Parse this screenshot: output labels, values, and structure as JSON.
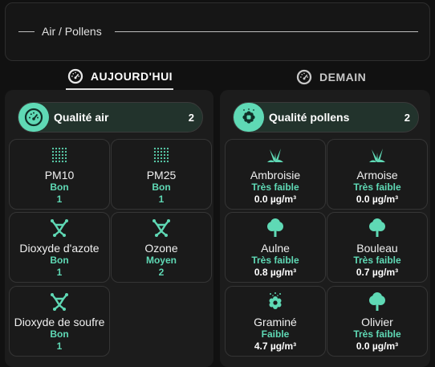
{
  "header": {
    "title": "Air / Pollens"
  },
  "tabs": [
    {
      "label": "AUJOURD'HUI",
      "icon": "gauge-icon",
      "active": true
    },
    {
      "label": "DEMAIN",
      "icon": "gauge-icon",
      "active": false
    }
  ],
  "air": {
    "summary": {
      "label": "Qualité air",
      "count": "2",
      "icon": "gauge-icon"
    },
    "items": [
      {
        "name": "PM10",
        "level": "Bon",
        "value": "1",
        "icon": "particles-icon"
      },
      {
        "name": "PM25",
        "level": "Bon",
        "value": "1",
        "icon": "particles-icon"
      },
      {
        "name": "Dioxyde d'azote",
        "level": "Bon",
        "value": "1",
        "icon": "molecule-icon"
      },
      {
        "name": "Ozone",
        "level": "Moyen",
        "value": "2",
        "icon": "molecule-icon"
      },
      {
        "name": "Dioxyde de soufre",
        "level": "Bon",
        "value": "1",
        "icon": "molecule-icon"
      }
    ]
  },
  "pollens": {
    "summary": {
      "label": "Qualité pollens",
      "count": "2",
      "icon": "flower-icon"
    },
    "items": [
      {
        "name": "Ambroisie",
        "level": "Très faible",
        "value": "0.0 µg/m³",
        "icon": "grass-icon"
      },
      {
        "name": "Armoise",
        "level": "Très faible",
        "value": "0.0 µg/m³",
        "icon": "grass-icon"
      },
      {
        "name": "Aulne",
        "level": "Très faible",
        "value": "0.8 µg/m³",
        "icon": "tree-icon"
      },
      {
        "name": "Bouleau",
        "level": "Très faible",
        "value": "0.7 µg/m³",
        "icon": "tree-icon"
      },
      {
        "name": "Graminé",
        "level": "Faible",
        "value": "4.7 µg/m³",
        "icon": "flower-icon"
      },
      {
        "name": "Olivier",
        "level": "Très faible",
        "value": "0.0 µg/m³",
        "icon": "tree-icon"
      }
    ]
  },
  "colors": {
    "accent": "#5fd9b5",
    "background": "#111111",
    "tile": "#1a1a1a"
  }
}
